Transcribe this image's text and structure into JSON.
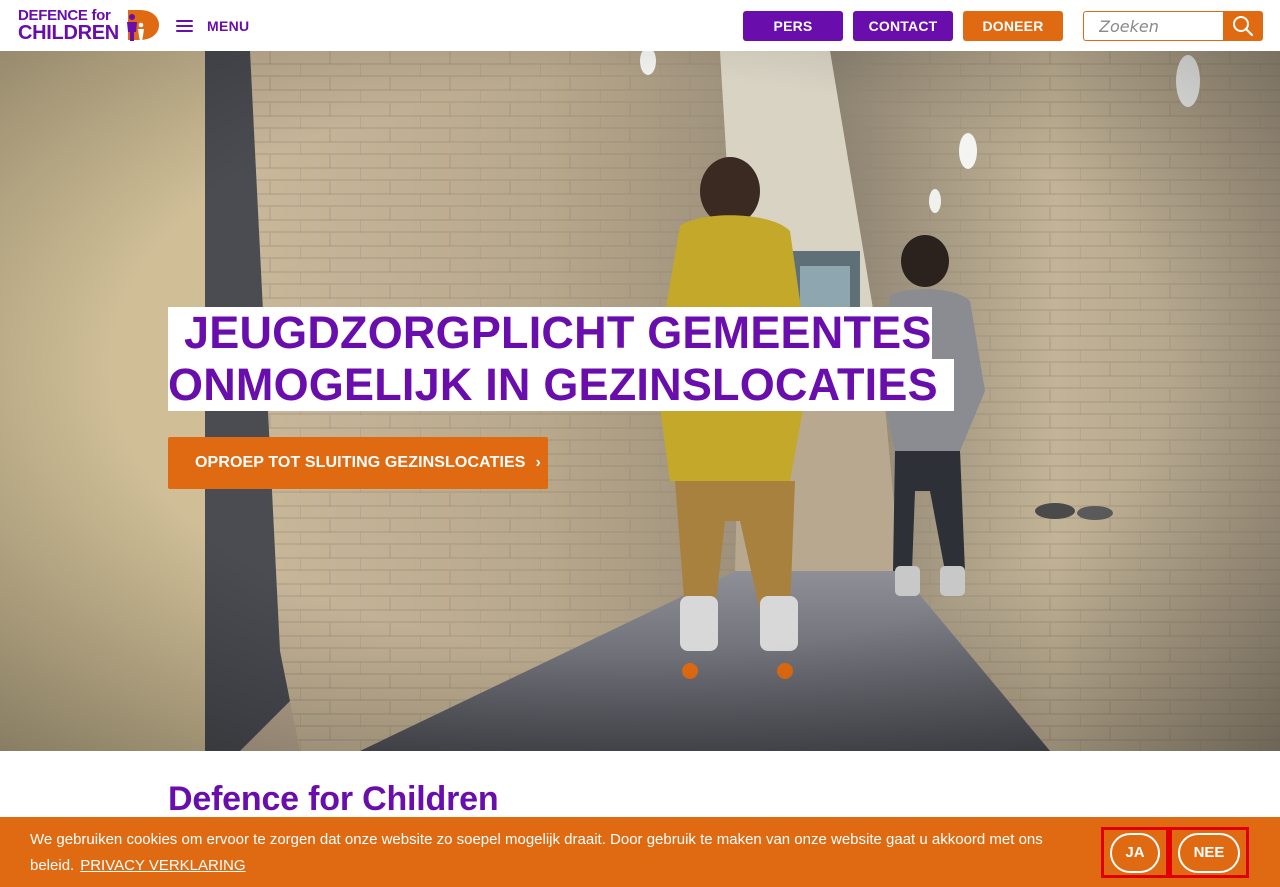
{
  "header": {
    "logo_line1": "DEFENCE for",
    "logo_line2": "CHILDREN",
    "menu_label": "MENU",
    "buttons": {
      "pers": "PERS",
      "contact": "CONTACT",
      "doneer": "DONEER"
    },
    "search": {
      "placeholder": "Zoeken"
    }
  },
  "hero": {
    "headline_line1": "JEUGDZORGPLICHT GEMEENTES",
    "headline_line2": "ONMOGELIJK IN GEZINSLOCATIES",
    "cta_label": "OPROEP TOT SLUITING GEZINSLOCATIES",
    "cta_chevron": "›"
  },
  "section": {
    "title": "Defence for Children"
  },
  "cookie": {
    "text": "We gebruiken cookies om ervoor te zorgen dat onze website zo soepel mogelijk draait. Door gebruik te maken van onze website gaat u akkoord met ons beleid.",
    "link_label": "PRIVACY VERKLARING",
    "accept_label": "JA",
    "decline_label": "NEE"
  },
  "colors": {
    "brand_purple": "#6a0dad",
    "brand_orange": "#e06a12",
    "highlight_red": "#e00000"
  },
  "icons": {
    "menu": "hamburger-icon",
    "search": "search-icon",
    "cta": "chevron-right-icon",
    "logo": "defence-for-children-logo"
  }
}
